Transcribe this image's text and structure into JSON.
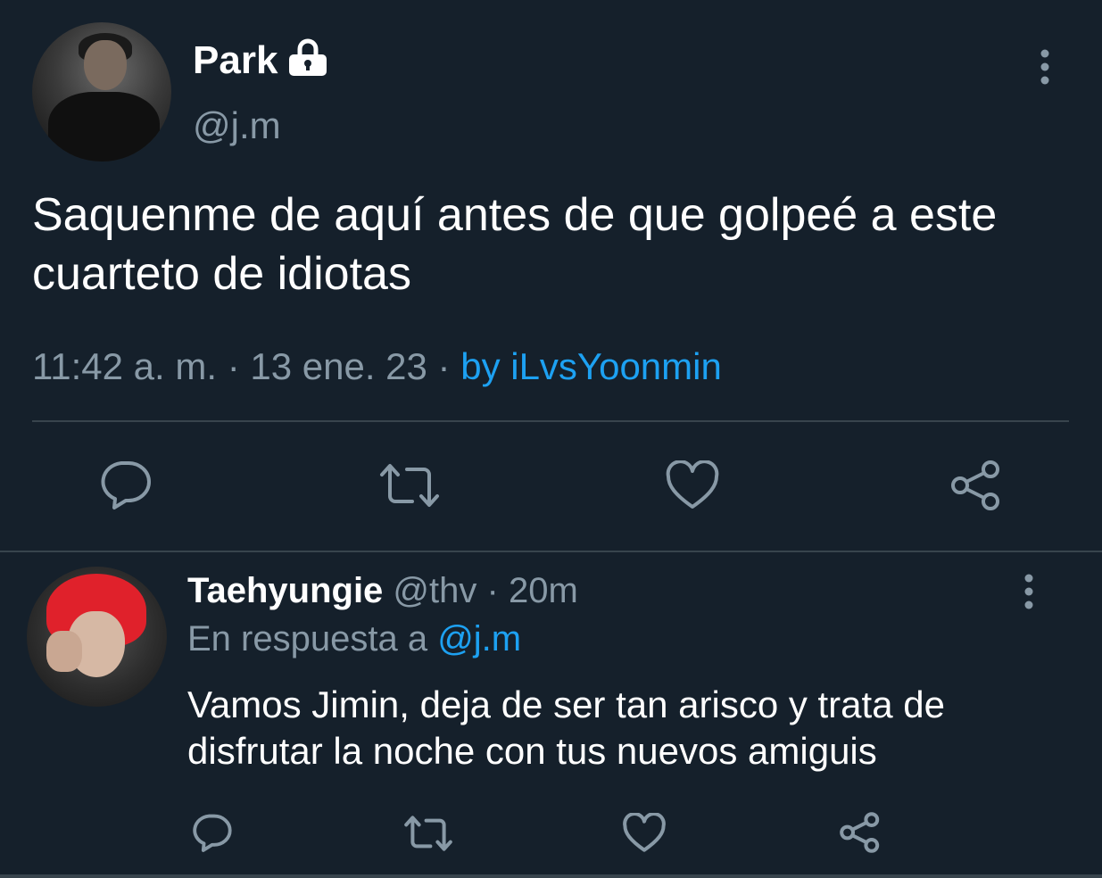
{
  "main_tweet": {
    "display_name": "Park",
    "handle": "@j.m",
    "text": "Saquenme de aquí antes de que golpeé a este cuarteto de idiotas",
    "time": "11:42 a. m.",
    "date": "13 ene. 23",
    "separator": "·",
    "source": "by iLvsYoonmin",
    "protected": true
  },
  "reply_tweet": {
    "display_name": "Taehyungie",
    "handle": "@thv",
    "separator": "·",
    "age": "20m",
    "reply_prefix": "En respuesta a",
    "reply_mention": "@j.m",
    "text": "Vamos Jimin, deja de ser tan arisco y trata de disfrutar la noche con tus nuevos amiguis"
  },
  "icons": {
    "lock": "lock-icon",
    "more": "more-vertical-icon",
    "reply": "reply-icon",
    "retweet": "retweet-icon",
    "like": "heart-icon",
    "share": "share-icon"
  },
  "colors": {
    "background": "#15202b",
    "secondary_text": "#8899a6",
    "link": "#1da1f2",
    "divider": "#38444d"
  }
}
